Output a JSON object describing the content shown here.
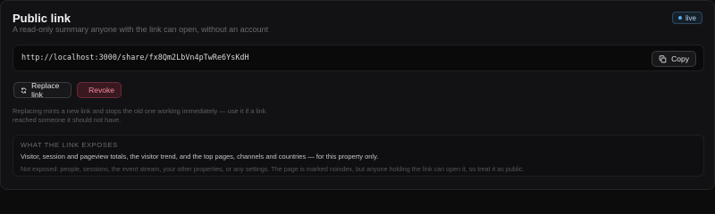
{
  "card": {
    "title": "Public link",
    "subtitle": "A read-only summary anyone with the link can open, without an account",
    "status_badge": "live"
  },
  "share": {
    "url": "http://localhost:3000/share/fx8Qm2LbVn4pTwRe6YsKdH",
    "copy_label": "Copy"
  },
  "actions": {
    "replace_label": "Replace link",
    "revoke_label": "Revoke"
  },
  "note": "Replacing mints a new link and stops the old one working immediately — use it if a link reached someone it should not have.",
  "exposes": {
    "heading": "WHAT THE LINK EXPOSES",
    "included": "Visitor, session and pageview totals, the visitor trend, and the top pages, channels and countries — for this property only.",
    "excluded": "Not exposed: people, sessions, the event stream, your other properties, or any settings. The page is marked noindex, but anyone holding the link can open it, so treat it as public."
  },
  "colors": {
    "live_accent": "#5aa8e0",
    "danger": "#f08a9a"
  },
  "icons": {
    "copy": "copy-icon",
    "replace": "refresh-icon",
    "revoke": "link-off-icon"
  }
}
